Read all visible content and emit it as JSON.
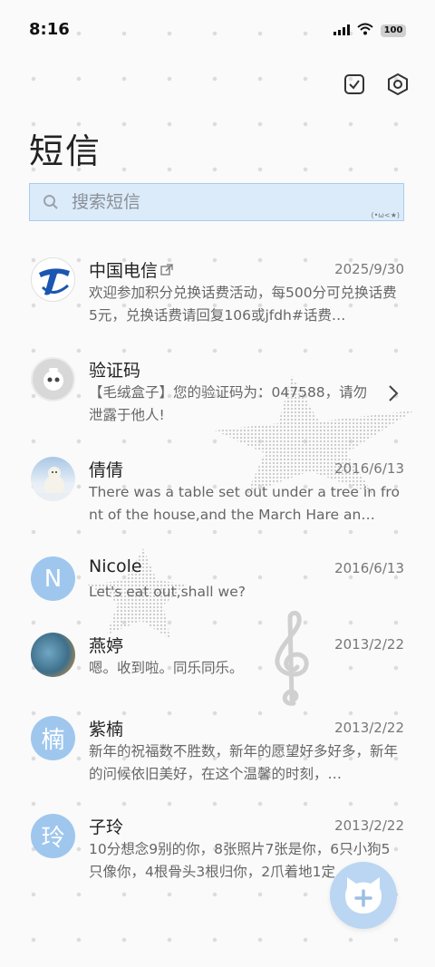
{
  "status": {
    "time": "8:16",
    "battery": "100"
  },
  "header": {
    "title": "短信"
  },
  "search": {
    "placeholder": "搜索短信",
    "kaomoji": "(•ω<★)"
  },
  "conversations": [
    {
      "name": "中国电信",
      "date": "2025/9/30",
      "preview": "欢迎参加积分兑换话费活动，每500分可兑换话费5元，兑换话费请回复106或jfdh#话费…"
    },
    {
      "name": "验证码",
      "date": "",
      "preview": "【毛绒盒子】您的验证码为：047588，请勿泄露于他人!"
    },
    {
      "name": "倩倩",
      "date": "2016/6/13",
      "preview": "There was a table set out under a tree in front of the house,and the March Hare an…"
    },
    {
      "name": "Nicole",
      "date": "2016/6/13",
      "preview": "Let's eat out,shall we?",
      "avatar_letter": "N"
    },
    {
      "name": "燕婷",
      "date": "2013/2/22",
      "preview": "嗯。收到啦。同乐同乐。"
    },
    {
      "name": "紫楠",
      "date": "2013/2/22",
      "preview": "新年的祝福数不胜数，新年的愿望好多好多，新年的问候依旧美好，在这个温馨的时刻，…",
      "avatar_letter": "楠"
    },
    {
      "name": "子玲",
      "date": "2013/2/22",
      "preview": "10分想念9别的你，8张照片7张是你，6只小狗5只像你，4根骨头3根归你，2爪着地1定…",
      "avatar_letter": "玲"
    }
  ],
  "colors": {
    "accent": "#9fc7ee",
    "search_bg": "#dcebfa",
    "fab": "#bad6f2"
  }
}
